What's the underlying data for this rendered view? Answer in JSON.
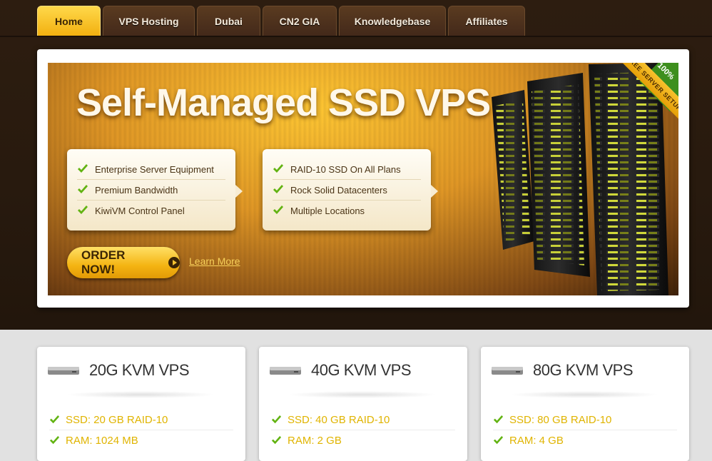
{
  "nav": {
    "tabs": [
      {
        "label": "Home",
        "active": true
      },
      {
        "label": "VPS Hosting",
        "active": false
      },
      {
        "label": "Dubai",
        "active": false
      },
      {
        "label": "CN2 GIA",
        "active": false
      },
      {
        "label": "Knowledgebase",
        "active": false
      },
      {
        "label": "Affiliates",
        "active": false
      }
    ]
  },
  "banner": {
    "title": "Self-Managed SSD VPS",
    "features_left": [
      "Enterprise Server Equipment",
      "Premium Bandwidth",
      "KiwiVM Control Panel"
    ],
    "features_right": [
      "RAID-10 SSD On All Plans",
      "Rock Solid Datacenters",
      "Multiple Locations"
    ],
    "order_label": "ORDER NOW!",
    "learn_more": "Learn More",
    "ribbon_text": "FREE SERVER SETUP",
    "badge_text": "100%"
  },
  "plans": [
    {
      "title": "20G KVM VPS",
      "features": [
        "SSD: 20 GB RAID-10",
        "RAM: 1024 MB"
      ]
    },
    {
      "title": "40G KVM VPS",
      "features": [
        "SSD: 40 GB RAID-10",
        "RAM: 2 GB"
      ]
    },
    {
      "title": "80G KVM VPS",
      "features": [
        "SSD: 80 GB RAID-10",
        "RAM: 4 GB"
      ]
    }
  ],
  "colors": {
    "accent": "#f2b010",
    "check": "#62b312",
    "feature_text": "#e0b400"
  },
  "icons": {
    "check": "check-icon",
    "drive": "hard-drive-icon",
    "arrow": "arrow-right-icon"
  }
}
